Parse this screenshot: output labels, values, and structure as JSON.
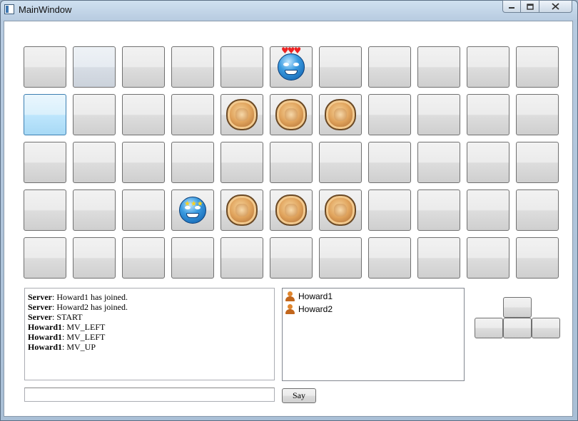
{
  "window": {
    "title": "MainWindow",
    "caption_buttons": [
      "minimize",
      "maximize",
      "close"
    ]
  },
  "board": {
    "rows": 5,
    "cols": 11,
    "cells": [
      [
        "empty",
        "pale",
        "empty",
        "empty",
        "empty",
        "player-love",
        "empty",
        "empty",
        "empty",
        "empty",
        "empty"
      ],
      [
        "hover",
        "empty",
        "empty",
        "empty",
        "coin",
        "coin",
        "coin",
        "empty",
        "empty",
        "empty",
        "empty"
      ],
      [
        "empty",
        "empty",
        "empty",
        "empty",
        "empty",
        "empty",
        "empty",
        "empty",
        "empty",
        "empty",
        "empty"
      ],
      [
        "empty",
        "empty",
        "empty",
        "player-dizzy",
        "coin",
        "coin",
        "coin",
        "empty",
        "empty",
        "empty",
        "empty"
      ],
      [
        "empty",
        "empty",
        "empty",
        "empty",
        "empty",
        "empty",
        "empty",
        "empty",
        "empty",
        "empty",
        "empty"
      ]
    ]
  },
  "chat": {
    "lines": [
      {
        "sender": "Server",
        "text": ": Howard1 has joined."
      },
      {
        "sender": "Server",
        "text": ": Howard2 has joined."
      },
      {
        "sender": "Server",
        "text": ": START"
      },
      {
        "sender": "Howard1",
        "text": ": MV_LEFT"
      },
      {
        "sender": "Howard1",
        "text": ": MV_LEFT"
      },
      {
        "sender": "Howard1",
        "text": ": MV_UP"
      }
    ],
    "input_value": "",
    "say_label": "Say"
  },
  "users": [
    {
      "name": "Howard1",
      "icon": "user-icon"
    },
    {
      "name": "Howard2",
      "icon": "user-icon"
    }
  ],
  "controls": {
    "directions": [
      "up",
      "left",
      "down",
      "right"
    ]
  }
}
